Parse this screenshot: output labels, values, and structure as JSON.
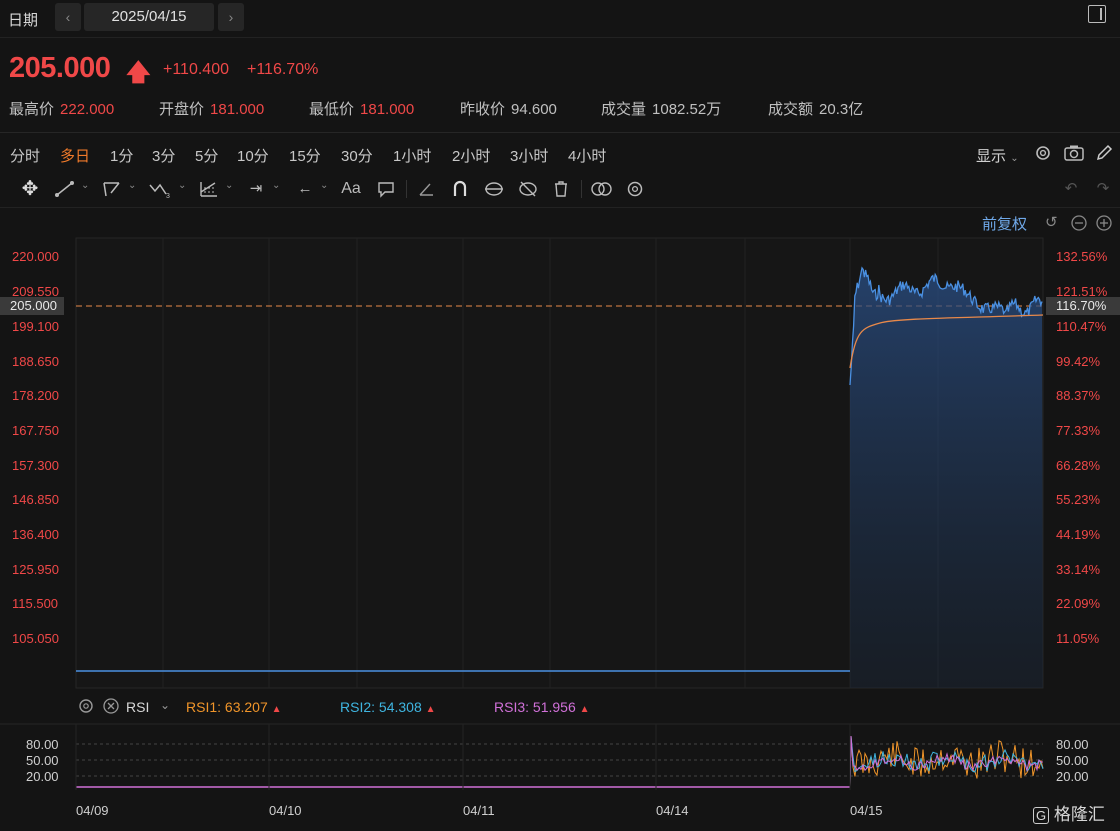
{
  "topbar": {
    "date_label": "日期",
    "prev_icon": "chevron-left-icon",
    "date_value": "2025/04/15",
    "next_icon": "chevron-right-icon",
    "panel_icon": "side-panel-icon"
  },
  "quote": {
    "price": "205.000",
    "change": "+110.400",
    "change_pct": "+116.70%",
    "stats": [
      {
        "label": "最高价",
        "value": "222.000",
        "color": "#f04848"
      },
      {
        "label": "开盘价",
        "value": "181.000",
        "color": "#f04848"
      },
      {
        "label": "最低价",
        "value": "181.000",
        "color": "#f04848"
      },
      {
        "label": "昨收价",
        "value": "94.600",
        "color": "#c0c0c0"
      },
      {
        "label": "成交量",
        "value": "1082.52万",
        "color": "#c0c0c0"
      },
      {
        "label": "成交额",
        "value": "20.3亿",
        "color": "#c0c0c0"
      }
    ]
  },
  "timeframes": {
    "items": [
      "分时",
      "多日",
      "1分",
      "3分",
      "5分",
      "10分",
      "15分",
      "30分",
      "1小时",
      "2小时",
      "3小时",
      "4小时"
    ],
    "active": "多日",
    "display_label": "显示"
  },
  "chart": {
    "adjust_label": "前复权",
    "price_labels": [
      "220.000",
      "209.550",
      "199.100",
      "188.650",
      "178.200",
      "167.750",
      "157.300",
      "146.850",
      "136.400",
      "125.950",
      "115.500",
      "105.050"
    ],
    "pct_labels": [
      "132.56%",
      "121.51%",
      "110.47%",
      "99.42%",
      "88.37%",
      "77.33%",
      "66.28%",
      "55.23%",
      "44.19%",
      "33.14%",
      "22.09%",
      "11.05%"
    ],
    "current_price_tag": "205.000",
    "current_pct_tag": "116.70%",
    "x_labels": [
      "04/09",
      "04/10",
      "04/11",
      "04/14",
      "04/15"
    ],
    "colors": {
      "line": "#4a90e2",
      "avg": "#e8894a",
      "up": "#f04848"
    }
  },
  "rsi": {
    "name": "RSI",
    "rsi1": "RSI1: 63.207",
    "rsi2": "RSI2: 54.308",
    "rsi3": "RSI3: 51.956",
    "levels": [
      "80.00",
      "50.00",
      "20.00"
    ],
    "colors": {
      "rsi1": "#f0952a",
      "rsi2": "#3fb5e0",
      "rsi3": "#d070d8"
    }
  },
  "watermark": "格隆汇"
}
